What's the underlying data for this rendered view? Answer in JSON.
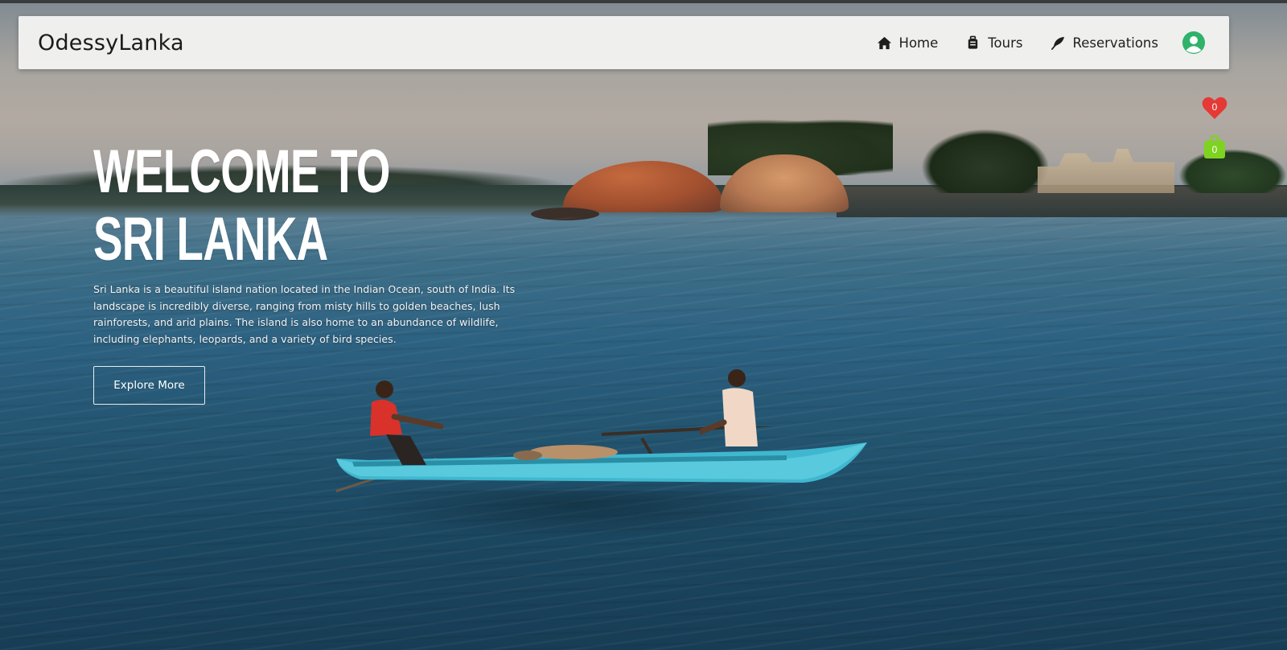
{
  "brand": {
    "name": "OdessyLanka"
  },
  "nav": {
    "items": [
      {
        "label": "Home",
        "icon": "home-icon"
      },
      {
        "label": "Tours",
        "icon": "suitcase-icon"
      },
      {
        "label": "Reservations",
        "icon": "feather-icon"
      }
    ],
    "user_icon": "user-avatar-icon"
  },
  "counters": {
    "favorites": {
      "count": "0",
      "icon": "heart-icon",
      "color": "#e53935"
    },
    "cart": {
      "count": "0",
      "icon": "shopping-bag-icon",
      "color": "#7ed321"
    }
  },
  "hero": {
    "title_line1": "WELCOME TO",
    "title_line2": "SRI LANKA",
    "description": "Sri Lanka is a beautiful island nation located in the Indian Ocean, south of India. Its landscape is incredibly diverse, ranging from misty hills to golden beaches, lush rainforests, and arid plains. The island is also home to an abundance of wildlife, including elephants, leopards, and a variety of bird species.",
    "button_label": "Explore More"
  },
  "colors": {
    "navbar_bg": "#f2f2f1",
    "user_icon": "#2fb36a",
    "hero_text": "#ffffff"
  }
}
